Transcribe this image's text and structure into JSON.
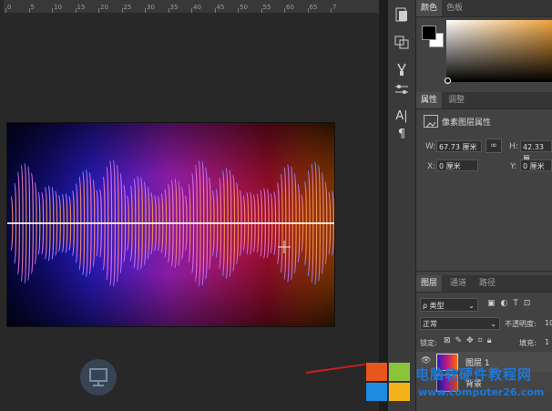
{
  "ruler": {
    "ticks": [
      "0",
      "5",
      "10",
      "15",
      "20",
      "25",
      "30",
      "35",
      "40",
      "45",
      "50",
      "55",
      "60",
      "65",
      "7"
    ]
  },
  "canvas": {
    "image_alt": "purple-orange sound wave image"
  },
  "toolbar": {
    "icons": [
      "adjust-icon",
      "clone-source-icon",
      "brush-preset-icon",
      "brush-settings-icon",
      "character-icon",
      "paragraph-icon"
    ],
    "char_glyph": "A|",
    "para_glyph": "¶"
  },
  "color_panel": {
    "tabs": [
      "颜色",
      "色板"
    ],
    "colors": {
      "foreground": "#000000",
      "background": "#ffffff"
    }
  },
  "properties_panel": {
    "tabs": [
      "属性",
      "调整"
    ],
    "section_title": "像素图层属性",
    "w_label": "W:",
    "w_value": "67.73 厘米",
    "h_label": "H:",
    "h_value": "42.33 厘",
    "x_label": "X:",
    "x_value": "0 厘米",
    "y_label": "Y:",
    "y_value": "0 厘米"
  },
  "layers_panel": {
    "tabs": [
      "图层",
      "通道",
      "路径"
    ],
    "filter_label": "ρ 类型",
    "blend_mode": "正常",
    "opacity_label": "不透明度:",
    "opacity_value": "10",
    "lock_label": "锁定:",
    "fill_label": "填充:",
    "fill_value": "1",
    "layers": [
      {
        "name": "图层 1"
      },
      {
        "name": "背景"
      }
    ]
  },
  "watermark": {
    "title": "电脑软硬件教程网",
    "url": "www.computer26.com"
  }
}
